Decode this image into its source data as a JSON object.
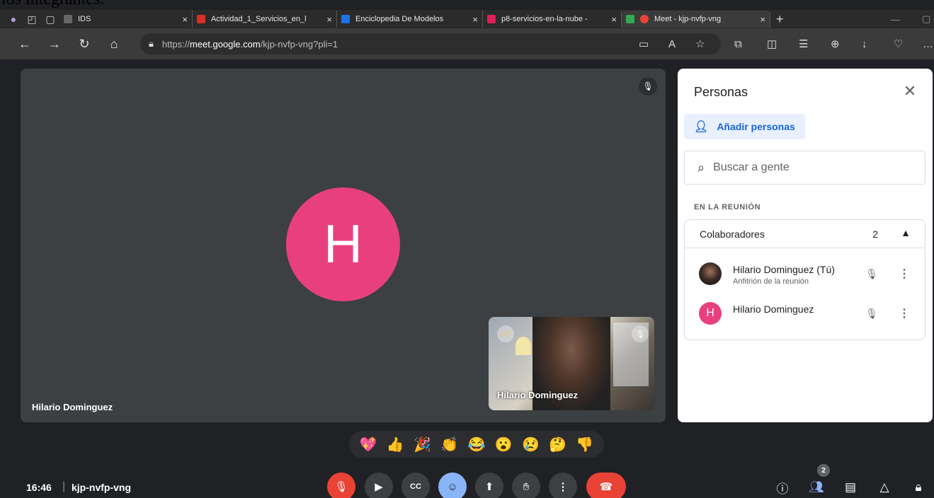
{
  "document_text": "los integrantes.",
  "browser": {
    "tabs": [
      {
        "title": "IDS",
        "color": "#666666",
        "active": false
      },
      {
        "title": "Actividad_1_Servicios_en_l",
        "color": "#d93025",
        "active": false
      },
      {
        "title": "Enciclopedia De Modelos",
        "color": "#1a73e8",
        "active": false
      },
      {
        "title": "p8-servicios-en-la-nube -",
        "color": "#e01e5a",
        "active": false
      },
      {
        "title": "Meet - kjp-nvfp-vng",
        "color": "#34a853",
        "active": true
      }
    ],
    "new_tab_glyph": "+",
    "close_glyph": "×",
    "url_prefix": "https://",
    "url_host": "meet.google.com",
    "url_path": "/kjp-nvfp-vng?pli=1"
  },
  "meeting": {
    "main_tile": {
      "initial": "H",
      "name": "Hilario Dominguez",
      "avatar_color": "#e8407e"
    },
    "self_tile": {
      "name": "Hilario Dominguez"
    },
    "time": "16:46",
    "separator": "|",
    "code": "kjp-nvfp-vng",
    "reactions": [
      "💖",
      "👍",
      "🎉",
      "👏",
      "😂",
      "😮",
      "😢",
      "🤔",
      "👎"
    ],
    "people_count_badge": "2"
  },
  "panel": {
    "title": "Personas",
    "add_button": "Añadir personas",
    "search_placeholder": "Buscar a gente",
    "section_label": "EN LA REUNIÓN",
    "group": {
      "name": "Colaboradores",
      "count": "2"
    },
    "people": [
      {
        "name": "Hilario Dominguez (Tú)",
        "subtitle": "Anfitrión de la reunión",
        "avatar": "photo"
      },
      {
        "name": "Hilario Dominguez",
        "subtitle": "",
        "avatar": "letter",
        "initial": "H"
      }
    ]
  }
}
